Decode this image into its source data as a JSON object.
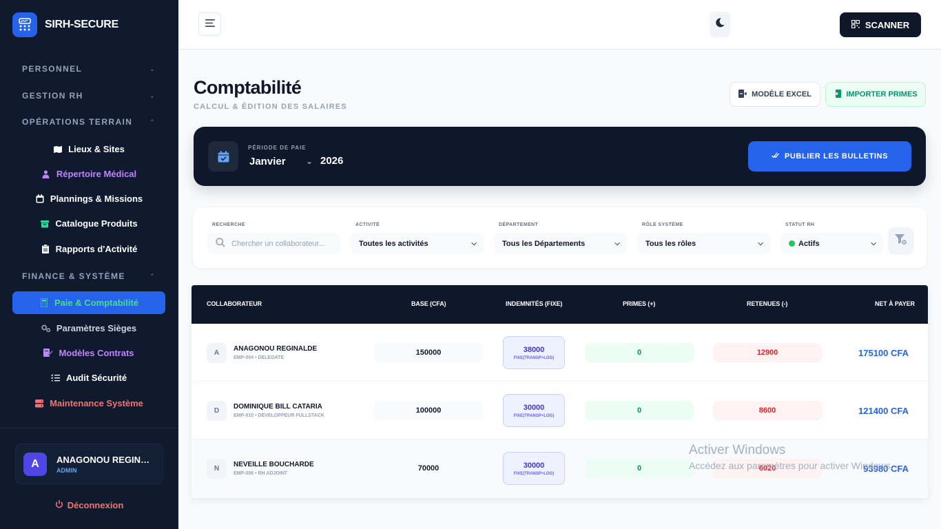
{
  "brand": {
    "name": "SIRH-SECURE"
  },
  "sidebar": {
    "sections": [
      {
        "label": "PERSONNEL"
      },
      {
        "label": "GESTION RH"
      },
      {
        "label": "OPÉRATIONS TERRAIN"
      },
      {
        "label": "FINANCE & SYSTÈME"
      }
    ],
    "items": [
      {
        "label": "Lieux & Sites",
        "color": "#ffffff"
      },
      {
        "label": "Répertoire Médical",
        "color": "#c084fc"
      },
      {
        "label": "Plannings & Missions",
        "color": "#ffffff"
      },
      {
        "label": "Catalogue Produits",
        "color": "#ffffff"
      },
      {
        "label": "Rapports d'Activité",
        "color": "#ffffff"
      },
      {
        "label": "Paie & Comptabilité",
        "color": "#4ade80"
      },
      {
        "label": "Paramètres Sièges",
        "color": "#cbd5e1"
      },
      {
        "label": "Modèles Contrats",
        "color": "#c084fc"
      },
      {
        "label": "Audit Sécurité",
        "color": "#ffffff"
      },
      {
        "label": "Maintenance Système",
        "color": "#f87171"
      }
    ],
    "user": {
      "initial": "A",
      "name": "ANAGONOU REGINALDE",
      "role": "ADMIN"
    },
    "logout_label": "Déconnexion"
  },
  "topbar": {
    "scanner_label": "SCANNER"
  },
  "page": {
    "title": "Comptabilité",
    "subtitle": "CALCUL & ÉDITION DES SALAIRES",
    "excel_label": "MODÈLE EXCEL",
    "import_label": "IMPORTER PRIMES"
  },
  "period": {
    "label": "PÉRIODE DE PAIE",
    "month": "Janvier",
    "year": "2026",
    "publish_label": "PUBLIER LES BULLETINS"
  },
  "filters": {
    "search": {
      "label": "RECHERCHE",
      "placeholder": "Chercher un collaborateur..."
    },
    "activity": {
      "label": "ACTIVITÉ",
      "value": "Toutes les activités"
    },
    "department": {
      "label": "DÉPARTEMENT",
      "value": "Tous les Départements"
    },
    "role": {
      "label": "RÔLE SYSTÈME",
      "value": "Tous les rôles"
    },
    "status": {
      "label": "STATUT RH",
      "value": "Actifs"
    }
  },
  "table": {
    "headers": [
      "COLLABORATEUR",
      "BASE (CFA)",
      "INDEMNITÉS (FIXE)",
      "PRIMES (+)",
      "RETENUES (-)",
      "NET À PAYER"
    ],
    "rows": [
      {
        "initial": "A",
        "name": "ANAGONOU REGINALDE",
        "meta": "EMP-004 • DELEGATE",
        "base": "150000",
        "ind": "38000",
        "ind_sub": "FIXE(TRANSP+LOG)",
        "primes": "0",
        "retenues": "12900",
        "net": "175100 CFA"
      },
      {
        "initial": "D",
        "name": "DOMINIQUE BILL CATARIA",
        "meta": "EMP-010 • DEVELOPPEUR FULLSTACK",
        "base": "100000",
        "ind": "30000",
        "ind_sub": "FIXE(TRANSP+LOG)",
        "primes": "0",
        "retenues": "8600",
        "net": "121400 CFA"
      },
      {
        "initial": "N",
        "name": "NEVEILLE BOUCHARDE",
        "meta": "EMP-006 • RH ADJOINT",
        "base": "70000",
        "ind": "30000",
        "ind_sub": "FIXE(TRANSP+LOG)",
        "primes": "0",
        "retenues": "6020",
        "net": "93980 CFA"
      }
    ]
  },
  "watermark": {
    "title": "Activer Windows",
    "subtitle": "Accédez aux paramètres pour activer Windows."
  }
}
